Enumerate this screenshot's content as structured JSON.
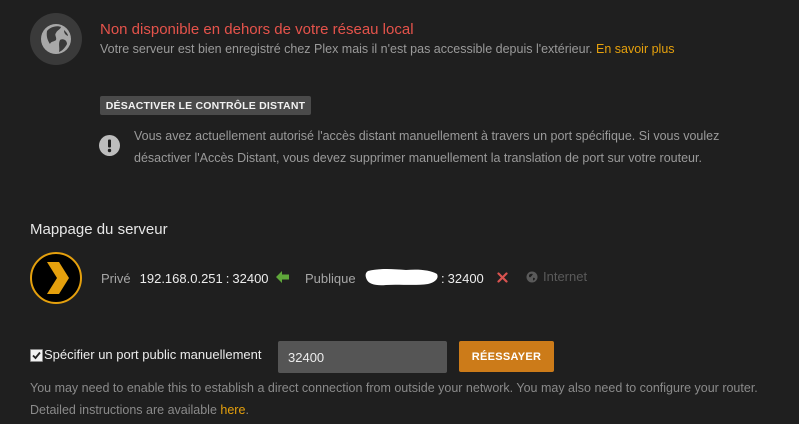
{
  "status": {
    "icon": "globe-icon",
    "title": "Non disponible en dehors de votre réseau local",
    "description": "Votre serveur est bien enregistré chez Plex mais il n'est pas accessible depuis l'extérieur.",
    "learn_more": "En savoir plus",
    "title_color": "#e5534b",
    "link_color": "#e5a00d"
  },
  "disable_button": "DÉSACTIVER LE CONTRÔLE DISTANT",
  "warning": {
    "icon": "exclamation-icon",
    "text": "Vous avez actuellement autorisé l'accès distant manuellement à travers un port spécifique. Si vous voulez désactiver l'Accès Distant, vous devez supprimer manuellement la translation de port sur votre routeur."
  },
  "mapping": {
    "title": "Mappage du serveur",
    "logo": "plex-chevron-logo",
    "private_label": "Privé",
    "private_ip": "192.168.0.251",
    "private_port": "32400",
    "separator": ":",
    "arrow_icon": "arrow-left-icon",
    "public_label": "Publique",
    "public_port": "32400",
    "fail_icon": "x-icon",
    "internet_icon": "globe-small-icon",
    "internet_label": "Internet"
  },
  "manual_port": {
    "checked": true,
    "label": "Spécifier un port public manuellement",
    "value": "32400",
    "retry_button": "RÉESSAYER",
    "retry_color": "#cc7b19",
    "help_text": "You may need to enable this to establish a direct connection from outside your network. You may also need to configure your router. Detailed instructions are available",
    "help_link": "here",
    "help_end": "."
  }
}
